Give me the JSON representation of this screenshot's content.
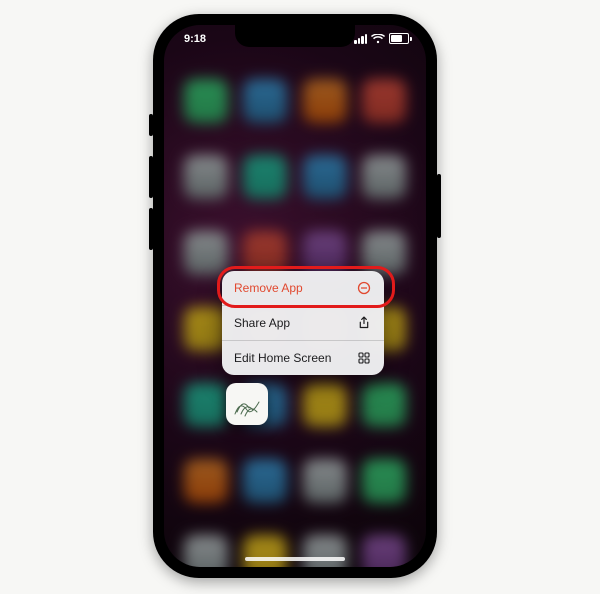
{
  "status": {
    "time": "9:18"
  },
  "menu": {
    "remove": "Remove App",
    "share": "Share App",
    "edit": "Edit Home Screen"
  },
  "annotation": {
    "highlight_color": "#e21b1b"
  }
}
